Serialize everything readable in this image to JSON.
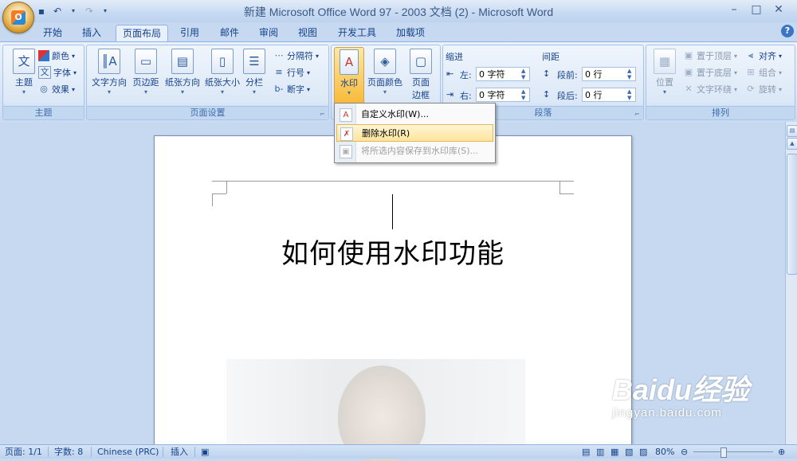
{
  "title_bar": {
    "title": "新建 Microsoft Office Word 97 - 2003 文档 (2) - Microsoft Word"
  },
  "tabs": [
    {
      "label": "开始"
    },
    {
      "label": "插入"
    },
    {
      "label": "页面布局"
    },
    {
      "label": "引用"
    },
    {
      "label": "邮件"
    },
    {
      "label": "审阅"
    },
    {
      "label": "视图"
    },
    {
      "label": "开发工具"
    },
    {
      "label": "加载项"
    }
  ],
  "active_tab": "页面布局",
  "ribbon": {
    "themes": {
      "label": "主题",
      "theme_btn": "主题",
      "colors": "颜色",
      "fonts": "字体",
      "effects": "效果"
    },
    "page_setup": {
      "label": "页面设置",
      "text_direction": "文字方向",
      "margins": "页边距",
      "orientation": "纸张方向",
      "size": "纸张大小",
      "columns": "分栏",
      "breaks": "分隔符",
      "line_numbers": "行号",
      "hyphenation": "断字"
    },
    "page_background": {
      "watermark": "水印",
      "page_color": "页面颜色",
      "page_borders_1": "页面",
      "page_borders_2": "边框"
    },
    "paragraph": {
      "label": "段落",
      "indent": "缩进",
      "spacing": "间距",
      "left_label": "左:",
      "left_value": "0 字符",
      "right_label": "右:",
      "right_value": "0 字符",
      "before_label": "段前:",
      "before_value": "0 行",
      "after_label": "段后:",
      "after_value": "0 行"
    },
    "arrange": {
      "label": "排列",
      "position": "位置",
      "bring_front": "置于顶层",
      "send_back": "置于底层",
      "text_wrap": "文字环绕",
      "align": "对齐",
      "group": "组合",
      "rotate": "旋转"
    }
  },
  "watermark_menu": {
    "items": [
      {
        "label": "自定义水印(W)...",
        "state": "normal"
      },
      {
        "label": "删除水印(R)",
        "state": "hover"
      },
      {
        "label": "将所选内容保存到水印库(S)...",
        "state": "disabled"
      }
    ]
  },
  "document": {
    "heading": "如何使用水印功能"
  },
  "status_bar": {
    "page": "页面: 1/1",
    "words": "字数: 8",
    "language": "Chinese (PRC)",
    "mode": "插入",
    "zoom": "80%"
  },
  "overlay": {
    "brand": "Baidu经验",
    "url": "jingyan.baidu.com"
  }
}
